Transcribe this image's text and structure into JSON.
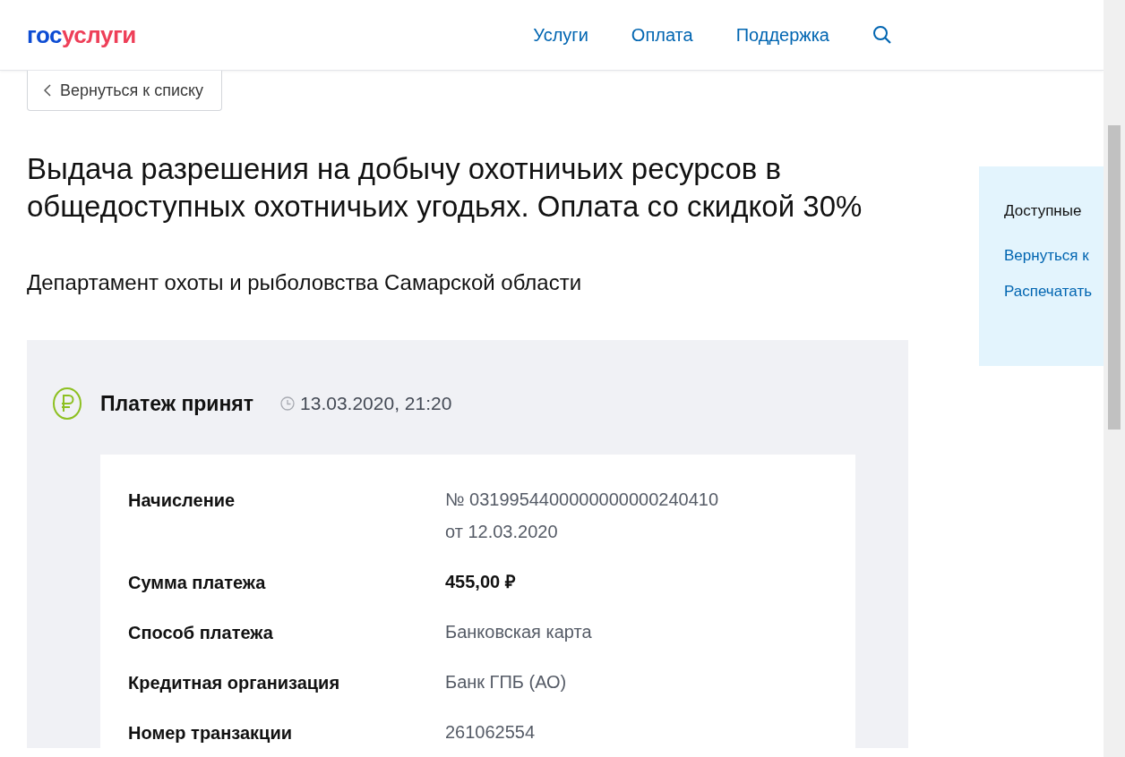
{
  "header": {
    "logo": {
      "part_1": "гос",
      "part_2": "услуги"
    },
    "nav": [
      {
        "label": "Услуги"
      },
      {
        "label": "Оплата"
      },
      {
        "label": "Поддержка"
      }
    ]
  },
  "back_button": {
    "label": "Вернуться к списку"
  },
  "title": "Выдача разрешения на добычу охотничьих ресурсов в общедоступных охотничьих угодьях. Оплата со скидкой 30%",
  "department": "Департамент охоты и рыболовства Самарской области",
  "payment": {
    "status": "Платеж принят",
    "datetime": "13.03.2020, 21:20",
    "rows": [
      {
        "label": "Начисление",
        "value_lines": [
          "№ 0319954400000000000240410",
          "от 12.03.2020"
        ],
        "bold": false
      },
      {
        "label": "Сумма платежа",
        "value_lines": [
          "455,00 ₽"
        ],
        "bold": true
      },
      {
        "label": "Способ платежа",
        "value_lines": [
          "Банковская карта"
        ],
        "bold": false
      },
      {
        "label": "Кредитная организация",
        "value_lines": [
          "Банк ГПБ (АО)"
        ],
        "bold": false
      },
      {
        "label": "Номер транзакции",
        "value_lines": [
          "261062554"
        ],
        "bold": false
      }
    ]
  },
  "sidebar": {
    "title": "Доступные",
    "links": [
      "Вернуться к",
      "Распечатать"
    ]
  }
}
